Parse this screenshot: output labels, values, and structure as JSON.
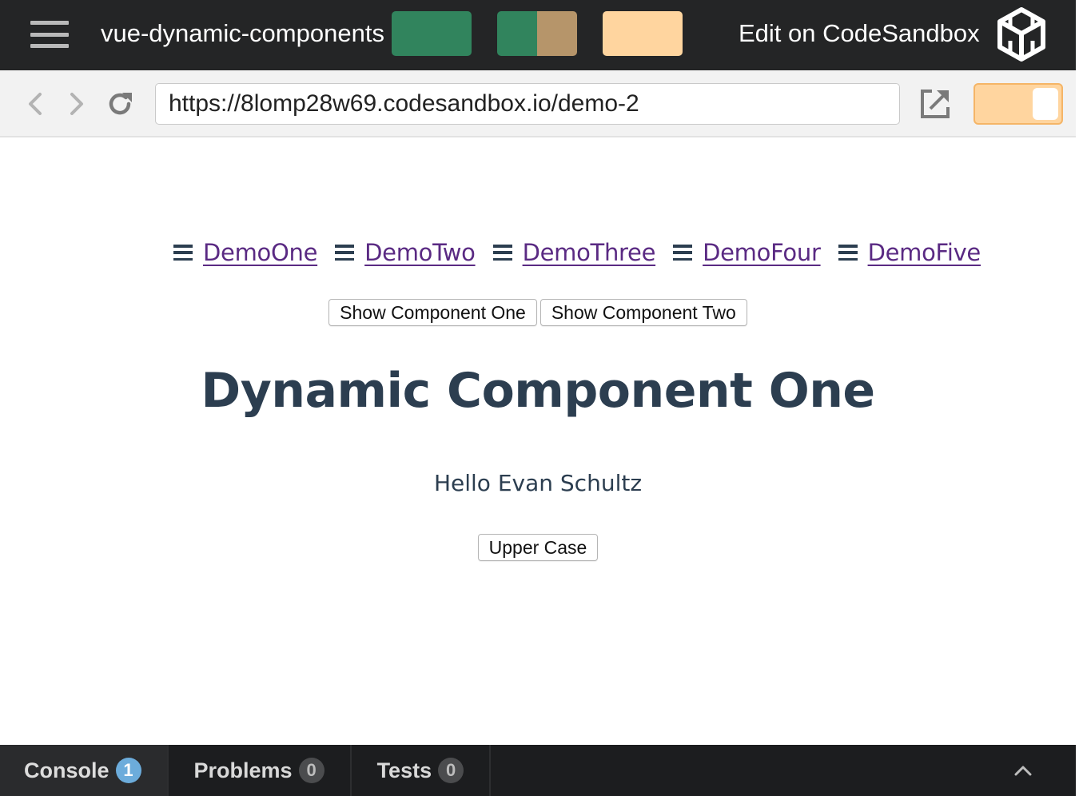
{
  "header": {
    "project_title": "vue-dynamic-components",
    "edit_link": "Edit on CodeSandbox",
    "swatches": {
      "swatch_1": "#31845d",
      "swatch_2_left": "#31845d",
      "swatch_2_right": "#b6956a",
      "swatch_3": "#ffd59f"
    },
    "background": "#242526"
  },
  "navbar": {
    "url": "https://8lomp28w69.codesandbox.io/demo-2",
    "toggle_color": "#ffd59f"
  },
  "preview": {
    "demo_links": [
      {
        "label": "DemoOne"
      },
      {
        "label": "DemoTwo"
      },
      {
        "label": "DemoThree"
      },
      {
        "label": "DemoFour"
      },
      {
        "label": "DemoFive"
      }
    ],
    "buttons": {
      "show_one": "Show Component One",
      "show_two": "Show Component Two",
      "upper_case": "Upper Case"
    },
    "heading": "Dynamic Component One",
    "greeting": "Hello Evan Schultz",
    "text_color": "#2c3e50",
    "link_color": "#5a2a83"
  },
  "devtools": {
    "tabs": [
      {
        "label": "Console",
        "count": "1"
      },
      {
        "label": "Problems",
        "count": "0"
      },
      {
        "label": "Tests",
        "count": "0"
      }
    ]
  }
}
